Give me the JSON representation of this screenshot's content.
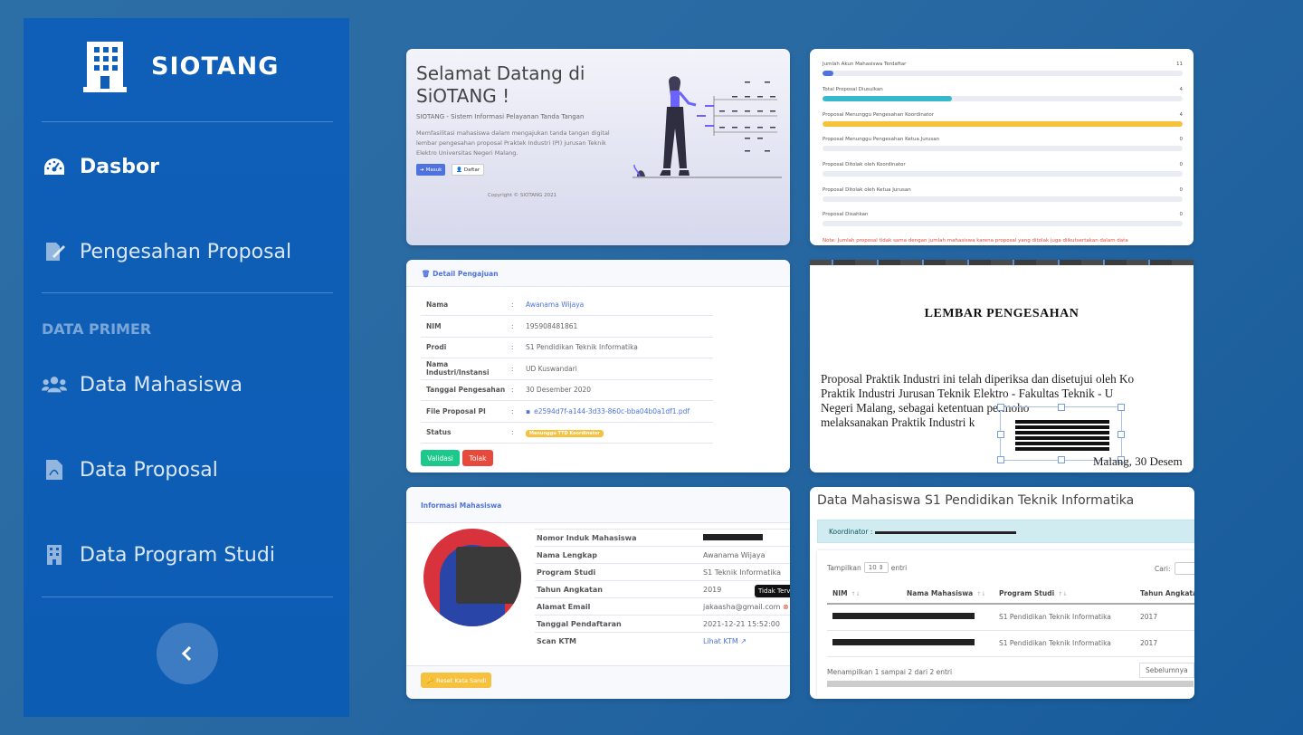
{
  "sidebar": {
    "brand": "SIOTANG",
    "items": [
      {
        "label": "Dasbor"
      },
      {
        "label": "Pengesahan Proposal"
      },
      {
        "label": "Data Mahasiswa"
      },
      {
        "label": "Data Proposal"
      },
      {
        "label": "Data Program Studi"
      }
    ],
    "section": "DATA PRIMER"
  },
  "welcome": {
    "title": "Selamat Datang di SiOTANG !",
    "subtitle": "SIOTANG - Sistem Informasi Pelayanan Tanda Tangan",
    "description": "Memfasilitasi mahasiswa dalam mengajukan tanda tangan digital lembar pengesahan proposal Praktek Industri (PI) jurusan Teknik Elektro Universitas Negeri Malang.",
    "masuk_label": "Masuk",
    "daftar_label": "Daftar",
    "copyright": "Copyright © SIOTANG 2021"
  },
  "stats": {
    "items": [
      {
        "label": "Jumlah Akun Mahasiswa Terdaftar",
        "value": "11",
        "fraction": 0.03,
        "color": "#4e73df"
      },
      {
        "label": "Total Proposal Diusulkan",
        "value": "4",
        "fraction": 0.36,
        "color": "#36b9cc"
      },
      {
        "label": "Proposal Menunggu Pengesahan Koordinator",
        "value": "4",
        "fraction": 1.0,
        "color": "#f6c23e"
      },
      {
        "label": "Proposal Menunggu Pengesahan Ketua Jurusan",
        "value": "0",
        "fraction": 0,
        "color": "#4e73df"
      },
      {
        "label": "Proposal Ditolak oleh Koordinator",
        "value": "0",
        "fraction": 0,
        "color": "#e74a3b"
      },
      {
        "label": "Proposal Ditolak oleh Ketua Jurusan",
        "value": "0",
        "fraction": 0,
        "color": "#e74a3b"
      },
      {
        "label": "Proposal Disahkan",
        "value": "0",
        "fraction": 0,
        "color": "#1cc88a"
      }
    ],
    "note": "Note: Jumlah proposal tidak sama dengan jumlah mahasiswa karena proposal yang ditolak juga diikutsertakan dalam data"
  },
  "detail": {
    "header": "Detail Pengajuan",
    "rows": [
      {
        "key": "Nama",
        "value": "Awanama Wijaya"
      },
      {
        "key": "NIM",
        "value": "195908481861"
      },
      {
        "key": "Prodi",
        "value": "S1 Pendidikan Teknik Informatika"
      },
      {
        "key": "Nama Industri/Instansi",
        "value": "UD Kuswandari"
      },
      {
        "key": "Tanggal Pengesahan",
        "value": "30 Desember 2020"
      },
      {
        "key": "File Proposal PI",
        "value": "e2594d7f-a144-3d33-860c-bba04b0a1df1.pdf"
      },
      {
        "key": "Status",
        "value": "Menunggu TTD Koordinator"
      }
    ],
    "colon": ":",
    "validasi_label": "Validasi",
    "tolak_label": "Tolak"
  },
  "document": {
    "title": "LEMBAR PENGESAHAN",
    "line1": "Proposal Praktik Industri ini telah diperiksa dan disetujui oleh Ko",
    "line2": "Praktik Industri Jurusan Teknik Elektro - Fakultas Teknik - U",
    "line3": "Negeri Malang, sebagai          ketentuan        permoho",
    "line4": "melaksanakan Praktik Industri k",
    "date": "Malang, 30 Desem"
  },
  "info": {
    "header": "Informasi Mahasiswa",
    "rows": [
      {
        "key": "Nomor Induk Mahasiswa",
        "value": ""
      },
      {
        "key": "Nama Lengkap",
        "value": "Awanama Wijaya"
      },
      {
        "key": "Program Studi",
        "value": "S1 Teknik Informatika"
      },
      {
        "key": "Tahun Angkatan",
        "value": "2019"
      },
      {
        "key": "Alamat Email",
        "value": "jakaasha@gmail.com"
      },
      {
        "key": "Tanggal Pendaftaran",
        "value": "2021-12-21 15:52:00"
      },
      {
        "key": "Scan KTM",
        "value": "Lihat KTM"
      }
    ],
    "tooltip": "Tidak Terve",
    "reset_label": "Reset Kata Sandi"
  },
  "table": {
    "title": "Data Mahasiswa S1 Pendidikan Teknik Informatika",
    "coordinator_label": "Koordinator :",
    "show_label": "Tampilkan",
    "entries_value": "10",
    "entries_label": "entri",
    "search_label": "Cari:",
    "columns": [
      "NIM",
      "Nama Mahasiswa",
      "Program Studi",
      "Tahun Angkatan"
    ],
    "rows": [
      {
        "prodi": "S1 Pendidikan Teknik Informatika",
        "tahun": "2017"
      },
      {
        "prodi": "S1 Pendidikan Teknik Informatika",
        "tahun": "2017"
      }
    ],
    "showing": "Menampilkan 1 sampai 2 dari 2 entri",
    "prev_label": "Sebelumnya"
  }
}
